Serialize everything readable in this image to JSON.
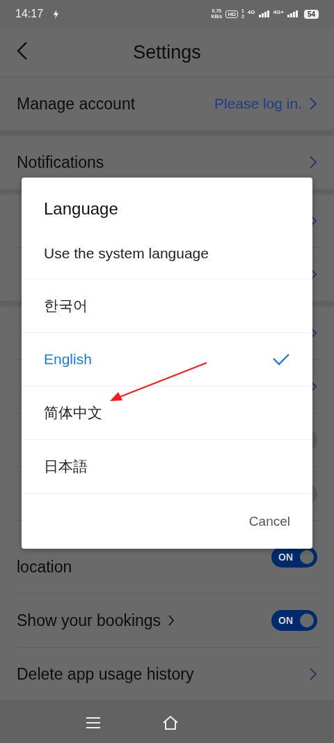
{
  "status_bar": {
    "time": "14:17",
    "net_speed": "0.70",
    "net_unit": "KB/s",
    "hd_badge": "HD",
    "sim_1": "1",
    "sim_2": "2",
    "signals": [
      "4G",
      "4G+"
    ],
    "battery": "54"
  },
  "header": {
    "title": "Settings"
  },
  "sections": [
    {
      "rows": [
        {
          "kind": "link",
          "label": "Manage account",
          "value": "Please log in."
        }
      ]
    },
    {
      "rows": [
        {
          "kind": "link",
          "label": "Notifications"
        }
      ]
    },
    {
      "rows": [
        {
          "kind": "link"
        },
        {
          "kind": "link"
        }
      ]
    },
    {
      "rows": [
        {
          "kind": "link"
        },
        {
          "kind": "link"
        },
        {
          "kind": "toggle",
          "on": false
        },
        {
          "kind": "toggle",
          "on": false
        },
        {
          "kind": "toggle",
          "label_2": "location",
          "on": true,
          "toggle_text": "ON"
        },
        {
          "kind": "toggle",
          "label": "Show your bookings",
          "chevron": true,
          "on": true,
          "toggle_text": "ON"
        },
        {
          "kind": "link",
          "label": "Delete app usage history"
        }
      ]
    }
  ],
  "dialog": {
    "title": "Language",
    "options": [
      {
        "label": "Use the system language",
        "selected": false
      },
      {
        "label": "한국어",
        "selected": false
      },
      {
        "label": "English",
        "selected": true
      },
      {
        "label": "简体中文",
        "selected": false
      },
      {
        "label": "日本語",
        "selected": false
      }
    ],
    "cancel": "Cancel"
  }
}
